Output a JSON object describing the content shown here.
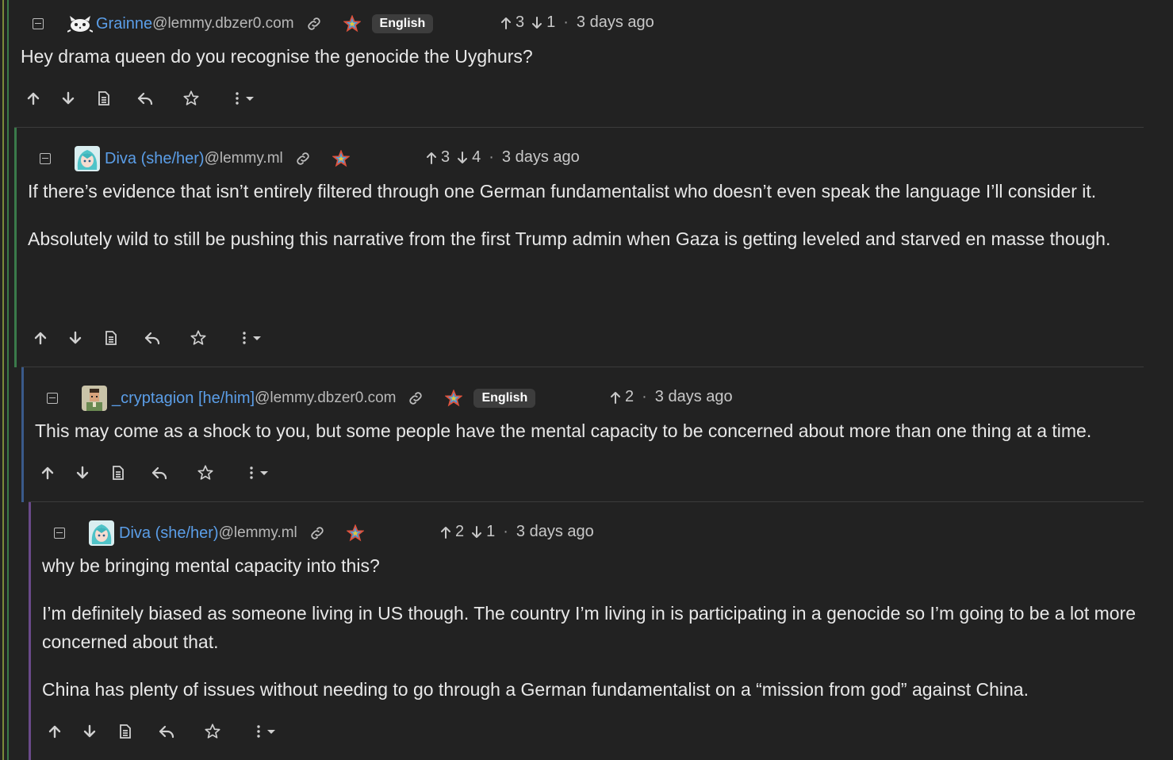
{
  "colors": {
    "background": "#222222",
    "username": "#5b9ee8",
    "instance": "#b8b8b8",
    "text": "#e8e8e8",
    "thread_lines": [
      "#7a8a3a",
      "#3a7a4a",
      "#8a6a2a",
      "#3a5a8a",
      "#6a4a8a"
    ]
  },
  "comments": [
    {
      "username": "Grainne",
      "instance": "@lemmy.dbzer0.com",
      "avatar": "white-cat-avatar",
      "language": "English",
      "upvotes": "3",
      "downvotes": "1",
      "time": "3 days ago",
      "paragraphs": [
        "Hey drama queen do you recognise the genocide the Uyghurs?"
      ]
    },
    {
      "username": "Diva (she/her)",
      "instance": "@lemmy.ml",
      "avatar": "anime-teal-hair-avatar",
      "language": "",
      "upvotes": "3",
      "downvotes": "4",
      "time": "3 days ago",
      "paragraphs": [
        "If there’s evidence that isn’t entirely filtered through one German fundamentalist who doesn’t even speak the language I’ll consider it.",
        "Absolutely wild to still be pushing this narrative from the first Trump admin when Gaza is getting leveled and starved en masse though."
      ]
    },
    {
      "username": "_cryptagion [he/him]",
      "instance": "@lemmy.dbzer0.com",
      "avatar": "pixel-person-avatar",
      "language": "English",
      "upvotes": "2",
      "downvotes": "",
      "time": "3 days ago",
      "paragraphs": [
        "This may come as a shock to you, but some people have the mental capacity to be concerned about more than one thing at a time."
      ]
    },
    {
      "username": "Diva (she/her)",
      "instance": "@lemmy.ml",
      "avatar": "anime-teal-hair-avatar",
      "language": "",
      "upvotes": "2",
      "downvotes": "1",
      "time": "3 days ago",
      "paragraphs": [
        "why be bringing mental capacity into this?",
        "I’m definitely biased as someone living in US though. The country I’m living in is participating in a genocide so I’m going to be a lot more concerned about that.",
        "China has plenty of issues without needing to go through a German fundamentalist on a “mission from god” against China."
      ]
    }
  ],
  "actions": [
    "upvote-icon",
    "downvote-icon",
    "view-source-icon",
    "reply-icon",
    "save-star-icon",
    "more-options-icon"
  ]
}
